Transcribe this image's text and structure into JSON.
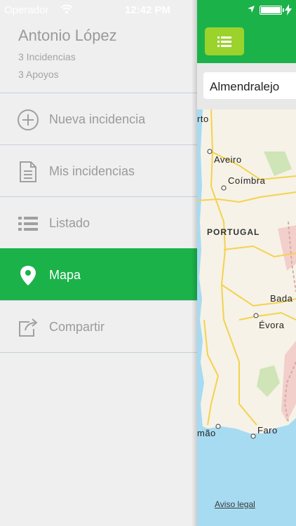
{
  "status_bar": {
    "carrier": "Operador",
    "time": "12:42 PM"
  },
  "user": {
    "name": "Antonio López",
    "incidencias": "3 Incidencias",
    "apoyos": "3 Apoyos"
  },
  "menu": {
    "items": [
      {
        "label": "Nueva incidencia",
        "icon": "plus-circle-icon",
        "active": false
      },
      {
        "label": "Mis incidencias",
        "icon": "document-icon",
        "active": false
      },
      {
        "label": "Listado",
        "icon": "list-icon",
        "active": false
      },
      {
        "label": "Mapa",
        "icon": "map-pin-icon",
        "active": true
      },
      {
        "label": "Compartir",
        "icon": "share-icon",
        "active": false
      }
    ]
  },
  "search": {
    "value": "Almendralejo"
  },
  "map": {
    "labels": {
      "porto": "rto",
      "aveiro": "Aveiro",
      "coimbra": "Coímbra",
      "portugal": "PORTUGAL",
      "badajoz": "Bada",
      "evora": "Évora",
      "portimao": "mão",
      "faro": "Faro"
    },
    "legal": "Aviso legal"
  },
  "colors": {
    "brand_green": "#1bb24a",
    "menu_button": "#9bd22c",
    "drawer_bg": "#efefef",
    "muted_text": "#9b9b9b",
    "sea": "#a7dbf2",
    "land": "#f6f2e7"
  }
}
